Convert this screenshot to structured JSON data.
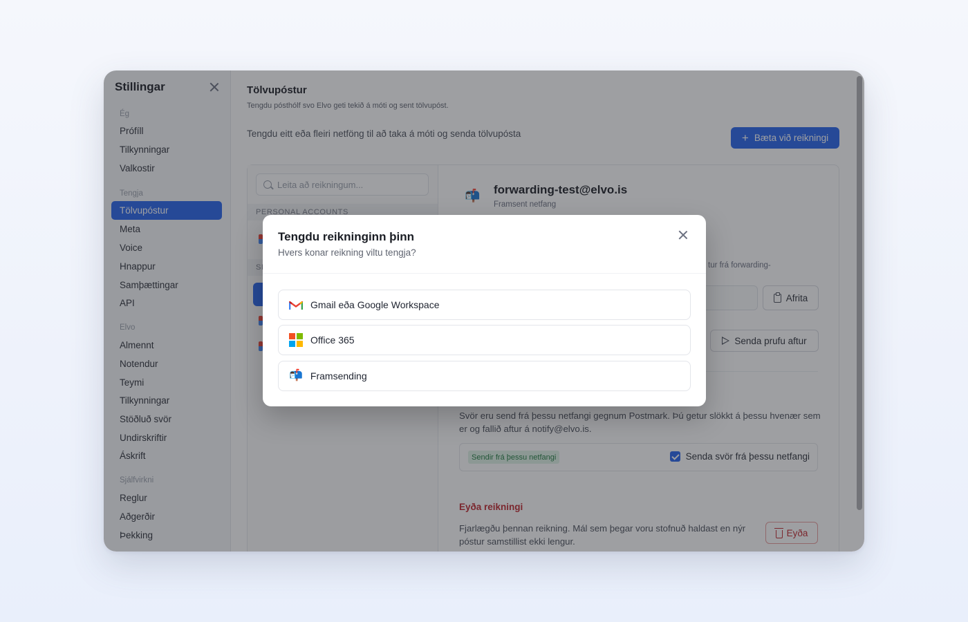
{
  "sidebar": {
    "title": "Stillingar",
    "sections": [
      {
        "label": "Ég",
        "items": [
          "Prófíll",
          "Tilkynningar",
          "Valkostir"
        ]
      },
      {
        "label": "Tengja",
        "items": [
          "Tölvupóstur",
          "Meta",
          "Voice",
          "Hnappur",
          "Samþættingar",
          "API"
        ]
      },
      {
        "label": "Elvo",
        "items": [
          "Almennt",
          "Notendur",
          "Teymi",
          "Tilkynningar",
          "Stöðluð svör",
          "Undirskriftir",
          "Áskrift"
        ]
      },
      {
        "label": "Sjálfvirkni",
        "items": [
          "Reglur",
          "Aðgerðir",
          "Þekking"
        ]
      }
    ],
    "active_item": "Tölvupóstur"
  },
  "main": {
    "title": "Tölvupóstur",
    "subtitle": "Tengdu pósthólf svo Elvo geti tekið á móti og sent tölvupóst.",
    "description": "Tengdu eitt eða fleiri netföng til að taka á móti og senda tölvupósta",
    "add_button": "Bæta við reikningi"
  },
  "account_list": {
    "search_placeholder": "Leita að reikningum...",
    "personal_header": "PERSONAL ACCOUNTS",
    "shared_header_partial": "SI"
  },
  "detail": {
    "account_email": "forwarding-test@elvo.is",
    "account_type": "Framsent netfang",
    "forward_text_partial": "tur frá forwarding-",
    "copy_button": "Afrita",
    "test_button": "Senda prufu aftur",
    "reply_description": "Svör eru send frá þessu netfangi gegnum Postmark. Þú getur slökkt á þessu hvenær sem er og fallið aftur á notify@elvo.is.",
    "reply_badge": "Sendir frá þessu netfangi",
    "reply_checkbox_label": "Senda svör frá þessu netfangi",
    "reply_checked": true,
    "delete_title": "Eyða reikningi",
    "delete_description": "Fjarlægðu þennan reikning. Mál sem þegar voru stofnuð haldast en nýr póstur samstillist ekki lengur.",
    "delete_button": "Eyða"
  },
  "modal": {
    "title": "Tengdu reikninginn þinn",
    "subtitle": "Hvers konar reikning viltu tengja?",
    "options": [
      {
        "label": "Gmail eða Google Workspace",
        "icon": "gmail-icon"
      },
      {
        "label": "Office 365",
        "icon": "microsoft-icon"
      },
      {
        "label": "Framsending",
        "icon": "mailbox-icon"
      }
    ]
  },
  "colors": {
    "accent": "#2563eb",
    "danger": "#c0262d",
    "success_bg": "#dff3e5",
    "success_text": "#1f7a3f"
  }
}
